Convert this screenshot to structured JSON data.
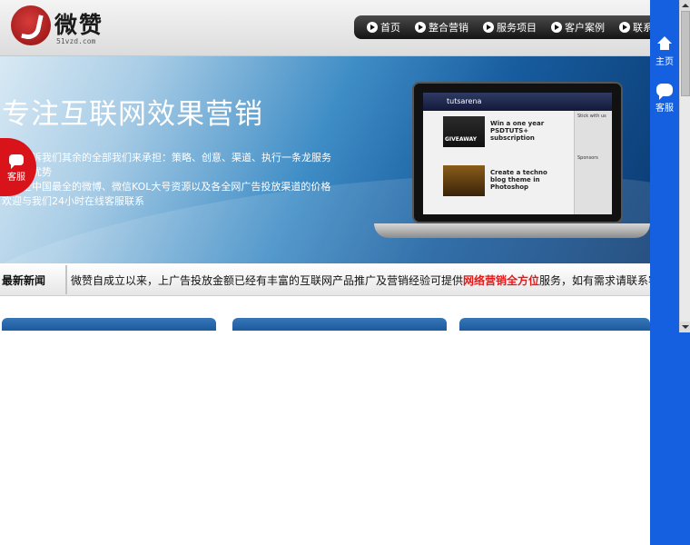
{
  "logo": {
    "text": "微赞",
    "subtext": "51vzd.com"
  },
  "nav": {
    "items": [
      "首页",
      "整合营销",
      "服务项目",
      "客户案例",
      "联系我们"
    ]
  },
  "hero": {
    "title": "专注互联网效果营销",
    "lines": [
      "广告告诉我们其余的全部我们来承担：策略、创意、渠道、执行一条龙服务",
      "我们的优势",
      "拥有全中国最全的微博、微信KOL大号资源以及各全网广告投放渠道的价格",
      "欢迎与我们24小时在线客服联系"
    ]
  },
  "screen": {
    "site_name": "tutsarena",
    "post1": "Win a one year PSDTUTS+ subscription",
    "post2": "Create a techno blog theme in Photoshop",
    "giveaway": "GIVEAWAY",
    "sidebar1": "Stick with us",
    "sidebar2": "Sponsors"
  },
  "news": {
    "label": "最新新闻",
    "text_before": "微赞自成立以来，上广告投放金额已经有丰富的互联网产品推广及营销经验可提供",
    "text_highlight": "网络营销全方位",
    "text_after": "服务，如有需求请联系客服。"
  },
  "sidebar": {
    "home_label": "主页",
    "chat_label": "客服"
  },
  "float_tab": {
    "label": "客服"
  },
  "colors": {
    "accent": "#1560e0",
    "highlight": "#e81818",
    "service_tab": "#d8141a"
  }
}
